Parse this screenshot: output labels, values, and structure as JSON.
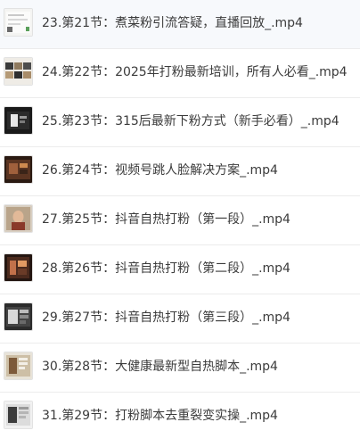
{
  "files": [
    {
      "name": "23.第21节：煮菜粉引流答疑，直播回放_.mp4",
      "thumb_icon": "video-thumbnail-icon"
    },
    {
      "name": "24.第22节：2025年打粉最新培训，所有人必看_.mp4",
      "thumb_icon": "video-thumbnail-icon"
    },
    {
      "name": "25.第23节：315后最新下粉方式（新手必看）_.mp4",
      "thumb_icon": "video-thumbnail-icon"
    },
    {
      "name": "26.第24节：视频号跳人脸解决方案_.mp4",
      "thumb_icon": "video-thumbnail-icon"
    },
    {
      "name": "27.第25节：抖音自热打粉（第一段）_.mp4",
      "thumb_icon": "video-thumbnail-icon"
    },
    {
      "name": "28.第26节：抖音自热打粉（第二段）_.mp4",
      "thumb_icon": "video-thumbnail-icon"
    },
    {
      "name": "29.第27节：抖音自热打粉（第三段）_.mp4",
      "thumb_icon": "video-thumbnail-icon"
    },
    {
      "name": "30.第28节：大健康最新型自热脚本_.mp4",
      "thumb_icon": "video-thumbnail-icon"
    },
    {
      "name": "31.第29节：打粉脚本去重裂变实操_.mp4",
      "thumb_icon": "video-thumbnail-icon"
    }
  ],
  "colors": {
    "text": "#3b3b3b",
    "divider": "#ececec",
    "background": "#ffffff"
  }
}
